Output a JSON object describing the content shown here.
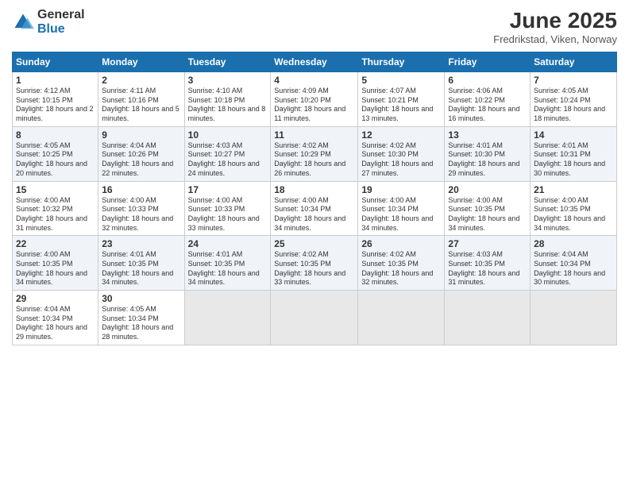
{
  "logo": {
    "general": "General",
    "blue": "Blue"
  },
  "title": "June 2025",
  "location": "Fredrikstad, Viken, Norway",
  "headers": [
    "Sunday",
    "Monday",
    "Tuesday",
    "Wednesday",
    "Thursday",
    "Friday",
    "Saturday"
  ],
  "weeks": [
    [
      {
        "day": "1",
        "sunrise": "Sunrise: 4:12 AM",
        "sunset": "Sunset: 10:15 PM",
        "daylight": "Daylight: 18 hours and 2 minutes."
      },
      {
        "day": "2",
        "sunrise": "Sunrise: 4:11 AM",
        "sunset": "Sunset: 10:16 PM",
        "daylight": "Daylight: 18 hours and 5 minutes."
      },
      {
        "day": "3",
        "sunrise": "Sunrise: 4:10 AM",
        "sunset": "Sunset: 10:18 PM",
        "daylight": "Daylight: 18 hours and 8 minutes."
      },
      {
        "day": "4",
        "sunrise": "Sunrise: 4:09 AM",
        "sunset": "Sunset: 10:20 PM",
        "daylight": "Daylight: 18 hours and 11 minutes."
      },
      {
        "day": "5",
        "sunrise": "Sunrise: 4:07 AM",
        "sunset": "Sunset: 10:21 PM",
        "daylight": "Daylight: 18 hours and 13 minutes."
      },
      {
        "day": "6",
        "sunrise": "Sunrise: 4:06 AM",
        "sunset": "Sunset: 10:22 PM",
        "daylight": "Daylight: 18 hours and 16 minutes."
      },
      {
        "day": "7",
        "sunrise": "Sunrise: 4:05 AM",
        "sunset": "Sunset: 10:24 PM",
        "daylight": "Daylight: 18 hours and 18 minutes."
      }
    ],
    [
      {
        "day": "8",
        "sunrise": "Sunrise: 4:05 AM",
        "sunset": "Sunset: 10:25 PM",
        "daylight": "Daylight: 18 hours and 20 minutes."
      },
      {
        "day": "9",
        "sunrise": "Sunrise: 4:04 AM",
        "sunset": "Sunset: 10:26 PM",
        "daylight": "Daylight: 18 hours and 22 minutes."
      },
      {
        "day": "10",
        "sunrise": "Sunrise: 4:03 AM",
        "sunset": "Sunset: 10:27 PM",
        "daylight": "Daylight: 18 hours and 24 minutes."
      },
      {
        "day": "11",
        "sunrise": "Sunrise: 4:02 AM",
        "sunset": "Sunset: 10:29 PM",
        "daylight": "Daylight: 18 hours and 26 minutes."
      },
      {
        "day": "12",
        "sunrise": "Sunrise: 4:02 AM",
        "sunset": "Sunset: 10:30 PM",
        "daylight": "Daylight: 18 hours and 27 minutes."
      },
      {
        "day": "13",
        "sunrise": "Sunrise: 4:01 AM",
        "sunset": "Sunset: 10:30 PM",
        "daylight": "Daylight: 18 hours and 29 minutes."
      },
      {
        "day": "14",
        "sunrise": "Sunrise: 4:01 AM",
        "sunset": "Sunset: 10:31 PM",
        "daylight": "Daylight: 18 hours and 30 minutes."
      }
    ],
    [
      {
        "day": "15",
        "sunrise": "Sunrise: 4:00 AM",
        "sunset": "Sunset: 10:32 PM",
        "daylight": "Daylight: 18 hours and 31 minutes."
      },
      {
        "day": "16",
        "sunrise": "Sunrise: 4:00 AM",
        "sunset": "Sunset: 10:33 PM",
        "daylight": "Daylight: 18 hours and 32 minutes."
      },
      {
        "day": "17",
        "sunrise": "Sunrise: 4:00 AM",
        "sunset": "Sunset: 10:33 PM",
        "daylight": "Daylight: 18 hours and 33 minutes."
      },
      {
        "day": "18",
        "sunrise": "Sunrise: 4:00 AM",
        "sunset": "Sunset: 10:34 PM",
        "daylight": "Daylight: 18 hours and 34 minutes."
      },
      {
        "day": "19",
        "sunrise": "Sunrise: 4:00 AM",
        "sunset": "Sunset: 10:34 PM",
        "daylight": "Daylight: 18 hours and 34 minutes."
      },
      {
        "day": "20",
        "sunrise": "Sunrise: 4:00 AM",
        "sunset": "Sunset: 10:35 PM",
        "daylight": "Daylight: 18 hours and 34 minutes."
      },
      {
        "day": "21",
        "sunrise": "Sunrise: 4:00 AM",
        "sunset": "Sunset: 10:35 PM",
        "daylight": "Daylight: 18 hours and 34 minutes."
      }
    ],
    [
      {
        "day": "22",
        "sunrise": "Sunrise: 4:00 AM",
        "sunset": "Sunset: 10:35 PM",
        "daylight": "Daylight: 18 hours and 34 minutes."
      },
      {
        "day": "23",
        "sunrise": "Sunrise: 4:01 AM",
        "sunset": "Sunset: 10:35 PM",
        "daylight": "Daylight: 18 hours and 34 minutes."
      },
      {
        "day": "24",
        "sunrise": "Sunrise: 4:01 AM",
        "sunset": "Sunset: 10:35 PM",
        "daylight": "Daylight: 18 hours and 34 minutes."
      },
      {
        "day": "25",
        "sunrise": "Sunrise: 4:02 AM",
        "sunset": "Sunset: 10:35 PM",
        "daylight": "Daylight: 18 hours and 33 minutes."
      },
      {
        "day": "26",
        "sunrise": "Sunrise: 4:02 AM",
        "sunset": "Sunset: 10:35 PM",
        "daylight": "Daylight: 18 hours and 32 minutes."
      },
      {
        "day": "27",
        "sunrise": "Sunrise: 4:03 AM",
        "sunset": "Sunset: 10:35 PM",
        "daylight": "Daylight: 18 hours and 31 minutes."
      },
      {
        "day": "28",
        "sunrise": "Sunrise: 4:04 AM",
        "sunset": "Sunset: 10:34 PM",
        "daylight": "Daylight: 18 hours and 30 minutes."
      }
    ],
    [
      {
        "day": "29",
        "sunrise": "Sunrise: 4:04 AM",
        "sunset": "Sunset: 10:34 PM",
        "daylight": "Daylight: 18 hours and 29 minutes."
      },
      {
        "day": "30",
        "sunrise": "Sunrise: 4:05 AM",
        "sunset": "Sunset: 10:34 PM",
        "daylight": "Daylight: 18 hours and 28 minutes."
      },
      null,
      null,
      null,
      null,
      null
    ]
  ]
}
